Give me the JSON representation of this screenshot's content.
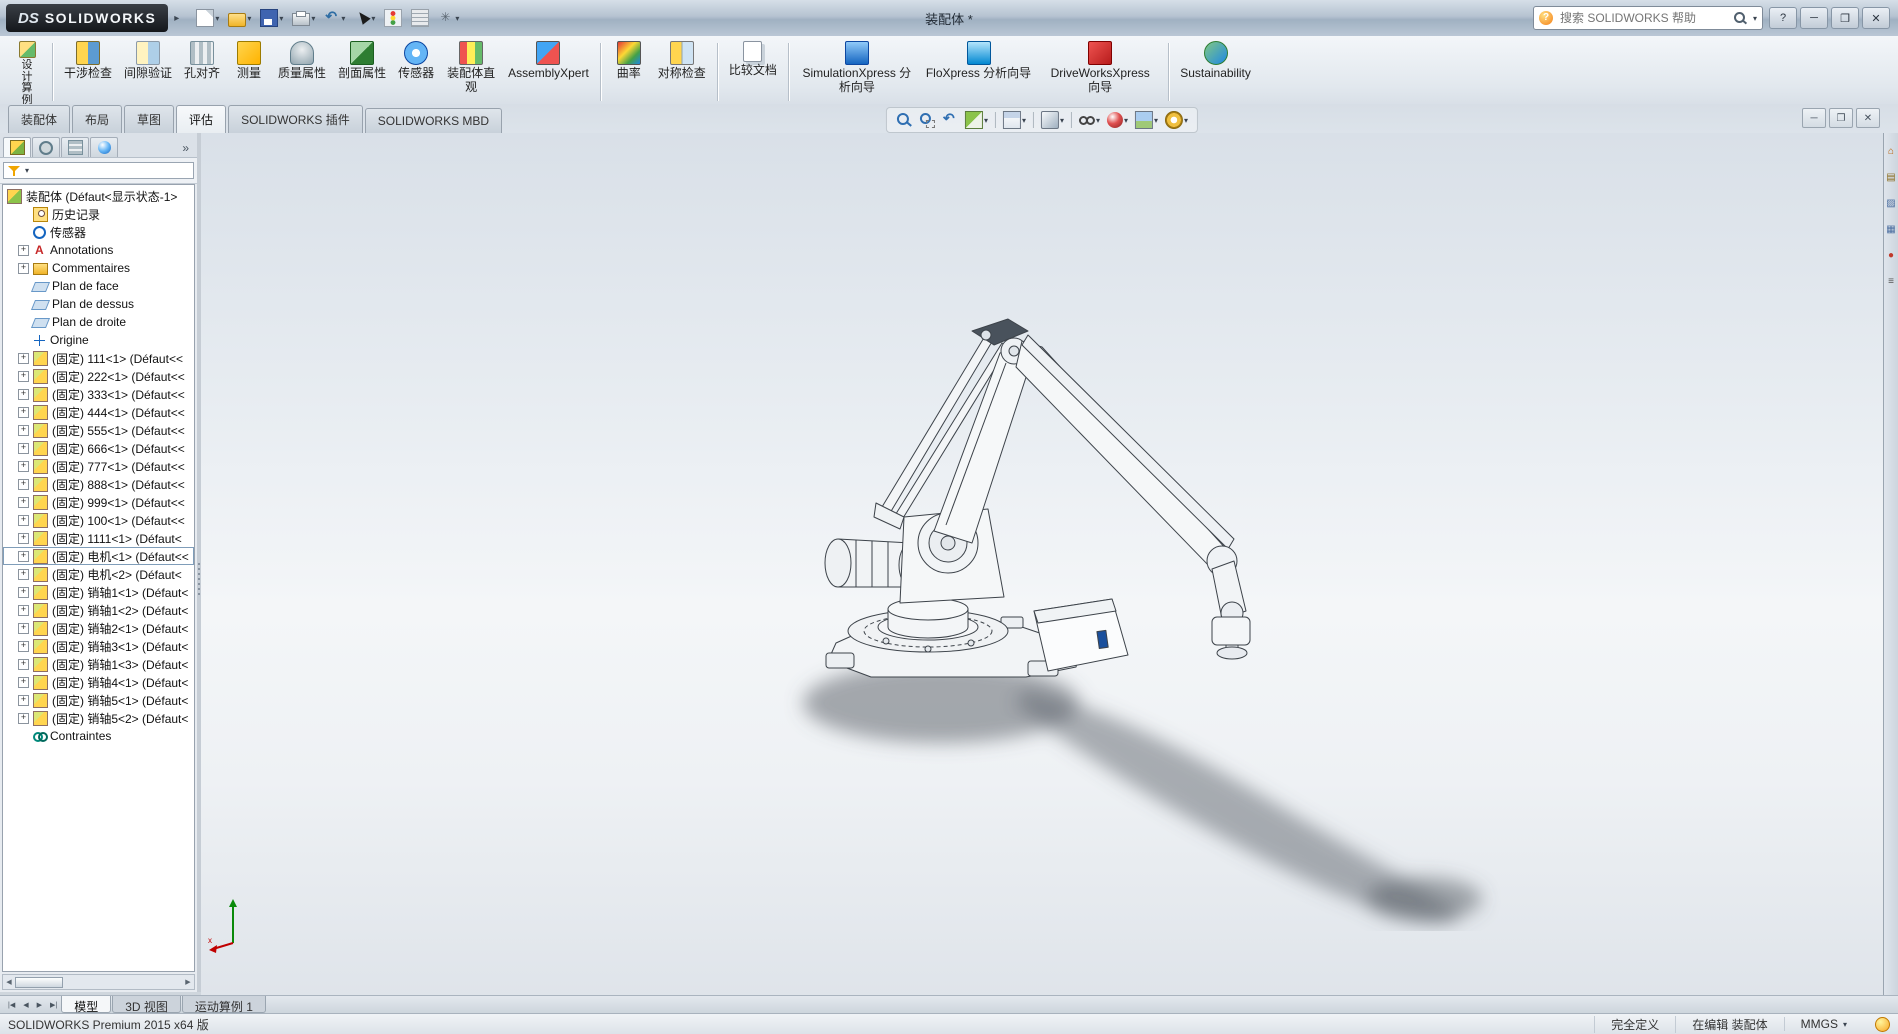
{
  "colors": {
    "titlebar_glass": "#aebccb",
    "ribbon": "#e6ebf1",
    "viewport_top": "#d9e0e8",
    "viewport_bottom": "#dfe4ea",
    "accent_blue": "#2f6fb2"
  },
  "titlebar": {
    "logo_text": "DS",
    "brand": "SOLIDWORKS",
    "title": "装配体 *",
    "search_placeholder": "搜索 SOLIDWORKS 帮助",
    "quick_access": [
      {
        "name": "new-document",
        "dd": true
      },
      {
        "name": "open",
        "dd": true
      },
      {
        "name": "save",
        "dd": true
      },
      {
        "name": "print",
        "dd": true
      },
      {
        "name": "undo",
        "dd": true
      },
      {
        "name": "select-cursor",
        "dd": true
      },
      {
        "name": "rebuild",
        "dd": false
      },
      {
        "name": "file-properties",
        "dd": false
      },
      {
        "name": "options",
        "dd": true
      }
    ],
    "window_controls": {
      "help": "?",
      "minimize": "─",
      "restore": "❐",
      "close": "✕"
    }
  },
  "command_tabs": [
    {
      "label": "装配体",
      "active": false
    },
    {
      "label": "布局",
      "active": false
    },
    {
      "label": "草图",
      "active": false
    },
    {
      "label": "评估",
      "active": true
    },
    {
      "label": "SOLIDWORKS 插件",
      "active": false
    },
    {
      "label": "SOLIDWORKS MBD",
      "active": false
    }
  ],
  "ribbon": {
    "buttons": [
      {
        "name": "design-study",
        "label": "设计算例",
        "vertical": true
      },
      {
        "name": "interference-detection",
        "label": "干涉检查",
        "sep_before": true
      },
      {
        "name": "clearance-verification",
        "label": "间隙验证"
      },
      {
        "name": "hole-alignment",
        "label": "孔对齐"
      },
      {
        "name": "measure",
        "label": "测量"
      },
      {
        "name": "mass-properties",
        "label": "质量属性"
      },
      {
        "name": "section-properties",
        "label": "剖面属性"
      },
      {
        "name": "sensor",
        "label": "传感器"
      },
      {
        "name": "assembly-visualization",
        "label": "装配体直观"
      },
      {
        "name": "assemblyxpert",
        "label": "AssemblyXpert"
      },
      {
        "name": "curvature",
        "label": "曲率",
        "sep_before": true
      },
      {
        "name": "symmetry-check",
        "label": "对称检查"
      },
      {
        "name": "compare-documents",
        "label": "比较文档",
        "sep_before": true
      },
      {
        "name": "simulationxpress",
        "label": "SimulationXpress 分析向导",
        "sep_before": true
      },
      {
        "name": "floxpress",
        "label": "FloXpress 分析向导"
      },
      {
        "name": "driveworksxpress",
        "label": "DriveWorksXpress 向导"
      },
      {
        "name": "sustainability",
        "label": "Sustainability",
        "sep_before": true
      }
    ]
  },
  "headsup": {
    "icons": [
      {
        "name": "zoom-fit"
      },
      {
        "name": "zoom-area"
      },
      {
        "name": "previous-view"
      },
      {
        "name": "section-view",
        "dd": true
      },
      {
        "sep": true
      },
      {
        "name": "view-orientation",
        "dd": true
      },
      {
        "sep": true
      },
      {
        "name": "display-style",
        "dd": true
      },
      {
        "sep": true
      },
      {
        "name": "hide-show-items",
        "dd": true
      },
      {
        "name": "edit-appearance",
        "dd": true
      },
      {
        "name": "apply-scene",
        "dd": true
      },
      {
        "name": "view-settings",
        "dd": true
      }
    ]
  },
  "doc_controls": [
    "minimize",
    "restore",
    "close"
  ],
  "feature_tree": {
    "panel_tabs": [
      "featuremanager",
      "propertymanager",
      "configurationmanager",
      "displaymanager"
    ],
    "overflow_chevron": "»",
    "items": [
      {
        "icon": "assembly",
        "label": "装配体 (Défaut<显示状态-1>",
        "root": true
      },
      {
        "icon": "history",
        "label": "历史记录"
      },
      {
        "icon": "sensors",
        "label": "传感器"
      },
      {
        "icon": "annotations",
        "label": "Annotations",
        "plus": true
      },
      {
        "icon": "folder",
        "label": "Commentaires",
        "plus": true
      },
      {
        "icon": "plane",
        "label": "Plan de face"
      },
      {
        "icon": "plane",
        "label": "Plan de dessus"
      },
      {
        "icon": "plane",
        "label": "Plan de droite"
      },
      {
        "icon": "origin",
        "label": "Origine"
      },
      {
        "icon": "part",
        "label": "(固定) 111<1> (Défaut<<",
        "plus": true
      },
      {
        "icon": "part",
        "label": "(固定) 222<1> (Défaut<<",
        "plus": true
      },
      {
        "icon": "part",
        "label": "(固定) 333<1> (Défaut<<",
        "plus": true
      },
      {
        "icon": "part",
        "label": "(固定) 444<1> (Défaut<<",
        "plus": true
      },
      {
        "icon": "part",
        "label": "(固定) 555<1> (Défaut<<",
        "plus": true
      },
      {
        "icon": "part",
        "label": "(固定) 666<1> (Défaut<<",
        "plus": true
      },
      {
        "icon": "part",
        "label": "(固定) 777<1> (Défaut<<",
        "plus": true
      },
      {
        "icon": "part",
        "label": "(固定) 888<1> (Défaut<<",
        "plus": true
      },
      {
        "icon": "part",
        "label": "(固定) 999<1> (Défaut<<",
        "plus": true
      },
      {
        "icon": "part",
        "label": "(固定) 100<1> (Défaut<<",
        "plus": true
      },
      {
        "icon": "part",
        "label": "(固定) 1111<1> (Défaut<",
        "plus": true
      },
      {
        "icon": "part",
        "label": "(固定) 电机<1> (Défaut<<",
        "plus": true,
        "focused": true
      },
      {
        "icon": "part",
        "label": "(固定) 电机<2> (Défaut<",
        "plus": true
      },
      {
        "icon": "part",
        "label": "(固定) 销轴1<1> (Défaut<",
        "plus": true
      },
      {
        "icon": "part",
        "label": "(固定) 销轴1<2> (Défaut<",
        "plus": true
      },
      {
        "icon": "part",
        "label": "(固定) 销轴2<1> (Défaut<",
        "plus": true
      },
      {
        "icon": "part",
        "label": "(固定) 销轴3<1> (Défaut<",
        "plus": true
      },
      {
        "icon": "part",
        "label": "(固定) 销轴1<3> (Défaut<",
        "plus": true
      },
      {
        "icon": "part",
        "label": "(固定) 销轴4<1> (Défaut<",
        "plus": true
      },
      {
        "icon": "part",
        "label": "(固定) 销轴5<1> (Défaut<",
        "plus": true
      },
      {
        "icon": "part",
        "label": "(固定) 销轴5<2> (Défaut<",
        "plus": true
      },
      {
        "icon": "mates",
        "label": "Contraintes"
      }
    ]
  },
  "viewport": {
    "triad": {
      "x_label": "x"
    }
  },
  "taskpane": {
    "icons": [
      "home",
      "design-library",
      "file-explorer",
      "view-palette",
      "appearances",
      "custom-properties"
    ]
  },
  "bottom_tabs": {
    "nav": [
      "first",
      "prev",
      "next",
      "last"
    ],
    "tabs": [
      {
        "label": "模型",
        "active": true
      },
      {
        "label": "3D 视图",
        "active": false
      },
      {
        "label": "运动算例 1",
        "active": false
      }
    ]
  },
  "statusbar": {
    "left": "SOLIDWORKS Premium 2015 x64 版",
    "defined": "完全定义",
    "editing": "在编辑 装配体",
    "units": "MMGS"
  }
}
